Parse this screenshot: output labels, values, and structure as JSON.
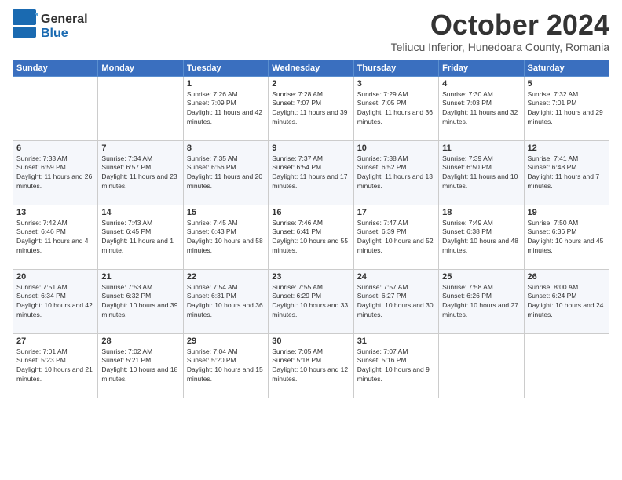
{
  "logo": {
    "general": "General",
    "blue": "Blue"
  },
  "title": "October 2024",
  "location": "Teliucu Inferior, Hunedoara County, Romania",
  "weekdays": [
    "Sunday",
    "Monday",
    "Tuesday",
    "Wednesday",
    "Thursday",
    "Friday",
    "Saturday"
  ],
  "weeks": [
    [
      {
        "day": "",
        "info": ""
      },
      {
        "day": "",
        "info": ""
      },
      {
        "day": "1",
        "info": "Sunrise: 7:26 AM\nSunset: 7:09 PM\nDaylight: 11 hours and 42 minutes."
      },
      {
        "day": "2",
        "info": "Sunrise: 7:28 AM\nSunset: 7:07 PM\nDaylight: 11 hours and 39 minutes."
      },
      {
        "day": "3",
        "info": "Sunrise: 7:29 AM\nSunset: 7:05 PM\nDaylight: 11 hours and 36 minutes."
      },
      {
        "day": "4",
        "info": "Sunrise: 7:30 AM\nSunset: 7:03 PM\nDaylight: 11 hours and 32 minutes."
      },
      {
        "day": "5",
        "info": "Sunrise: 7:32 AM\nSunset: 7:01 PM\nDaylight: 11 hours and 29 minutes."
      }
    ],
    [
      {
        "day": "6",
        "info": "Sunrise: 7:33 AM\nSunset: 6:59 PM\nDaylight: 11 hours and 26 minutes."
      },
      {
        "day": "7",
        "info": "Sunrise: 7:34 AM\nSunset: 6:57 PM\nDaylight: 11 hours and 23 minutes."
      },
      {
        "day": "8",
        "info": "Sunrise: 7:35 AM\nSunset: 6:56 PM\nDaylight: 11 hours and 20 minutes."
      },
      {
        "day": "9",
        "info": "Sunrise: 7:37 AM\nSunset: 6:54 PM\nDaylight: 11 hours and 17 minutes."
      },
      {
        "day": "10",
        "info": "Sunrise: 7:38 AM\nSunset: 6:52 PM\nDaylight: 11 hours and 13 minutes."
      },
      {
        "day": "11",
        "info": "Sunrise: 7:39 AM\nSunset: 6:50 PM\nDaylight: 11 hours and 10 minutes."
      },
      {
        "day": "12",
        "info": "Sunrise: 7:41 AM\nSunset: 6:48 PM\nDaylight: 11 hours and 7 minutes."
      }
    ],
    [
      {
        "day": "13",
        "info": "Sunrise: 7:42 AM\nSunset: 6:46 PM\nDaylight: 11 hours and 4 minutes."
      },
      {
        "day": "14",
        "info": "Sunrise: 7:43 AM\nSunset: 6:45 PM\nDaylight: 11 hours and 1 minute."
      },
      {
        "day": "15",
        "info": "Sunrise: 7:45 AM\nSunset: 6:43 PM\nDaylight: 10 hours and 58 minutes."
      },
      {
        "day": "16",
        "info": "Sunrise: 7:46 AM\nSunset: 6:41 PM\nDaylight: 10 hours and 55 minutes."
      },
      {
        "day": "17",
        "info": "Sunrise: 7:47 AM\nSunset: 6:39 PM\nDaylight: 10 hours and 52 minutes."
      },
      {
        "day": "18",
        "info": "Sunrise: 7:49 AM\nSunset: 6:38 PM\nDaylight: 10 hours and 48 minutes."
      },
      {
        "day": "19",
        "info": "Sunrise: 7:50 AM\nSunset: 6:36 PM\nDaylight: 10 hours and 45 minutes."
      }
    ],
    [
      {
        "day": "20",
        "info": "Sunrise: 7:51 AM\nSunset: 6:34 PM\nDaylight: 10 hours and 42 minutes."
      },
      {
        "day": "21",
        "info": "Sunrise: 7:53 AM\nSunset: 6:32 PM\nDaylight: 10 hours and 39 minutes."
      },
      {
        "day": "22",
        "info": "Sunrise: 7:54 AM\nSunset: 6:31 PM\nDaylight: 10 hours and 36 minutes."
      },
      {
        "day": "23",
        "info": "Sunrise: 7:55 AM\nSunset: 6:29 PM\nDaylight: 10 hours and 33 minutes."
      },
      {
        "day": "24",
        "info": "Sunrise: 7:57 AM\nSunset: 6:27 PM\nDaylight: 10 hours and 30 minutes."
      },
      {
        "day": "25",
        "info": "Sunrise: 7:58 AM\nSunset: 6:26 PM\nDaylight: 10 hours and 27 minutes."
      },
      {
        "day": "26",
        "info": "Sunrise: 8:00 AM\nSunset: 6:24 PM\nDaylight: 10 hours and 24 minutes."
      }
    ],
    [
      {
        "day": "27",
        "info": "Sunrise: 7:01 AM\nSunset: 5:23 PM\nDaylight: 10 hours and 21 minutes."
      },
      {
        "day": "28",
        "info": "Sunrise: 7:02 AM\nSunset: 5:21 PM\nDaylight: 10 hours and 18 minutes."
      },
      {
        "day": "29",
        "info": "Sunrise: 7:04 AM\nSunset: 5:20 PM\nDaylight: 10 hours and 15 minutes."
      },
      {
        "day": "30",
        "info": "Sunrise: 7:05 AM\nSunset: 5:18 PM\nDaylight: 10 hours and 12 minutes."
      },
      {
        "day": "31",
        "info": "Sunrise: 7:07 AM\nSunset: 5:16 PM\nDaylight: 10 hours and 9 minutes."
      },
      {
        "day": "",
        "info": ""
      },
      {
        "day": "",
        "info": ""
      }
    ]
  ]
}
